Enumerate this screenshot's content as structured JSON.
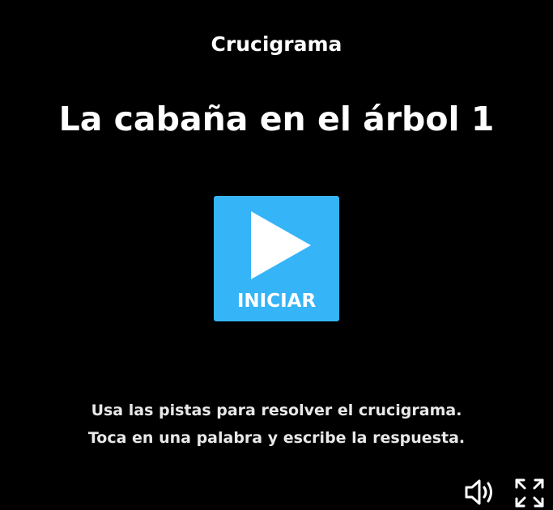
{
  "activity": {
    "type_label": "Crucigrama",
    "title": "La cabaña en el árbol 1"
  },
  "start_button": {
    "label": "INICIAR",
    "icon": "play-icon",
    "color": "#35b4f8"
  },
  "instructions": {
    "line1": "Usa las pistas para resolver el crucigrama.",
    "line2": "Toca en una palabra y escribe la respuesta."
  },
  "controls": {
    "sound_icon": "speaker-icon",
    "fullscreen_icon": "fullscreen-icon"
  },
  "colors": {
    "background": "#000000",
    "text": "#ffffff"
  }
}
